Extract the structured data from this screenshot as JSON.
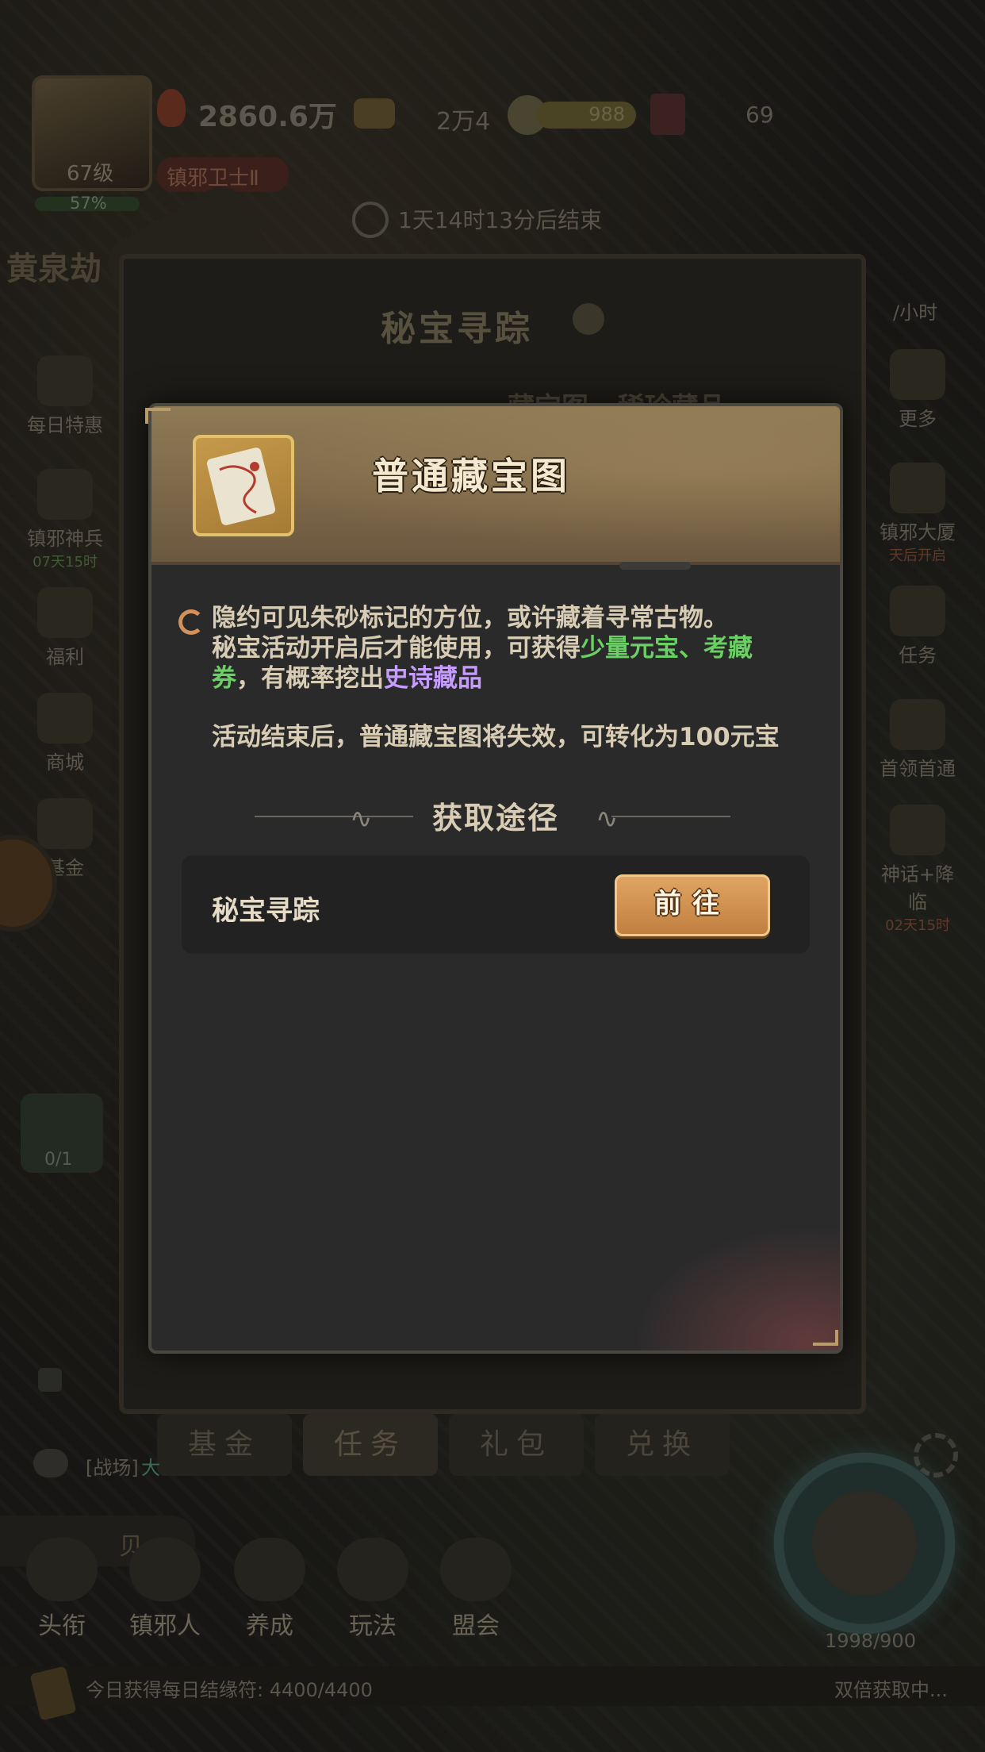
{
  "background": {
    "player": {
      "level": "67级",
      "xp_percent": "57%",
      "title_badge": "镇邪卫士Ⅱ"
    },
    "resources": {
      "power": "2860.6万",
      "gold": "2万4",
      "energy": "988",
      "tickets": "69"
    },
    "event_timer": "1天14时13分后结束",
    "event_name": "黄泉劫",
    "board_title": "秘宝寻踪",
    "board_banner": "藏宝图 · 稀珍藏品",
    "left_menu": [
      {
        "label": "每日特惠",
        "sub": ""
      },
      {
        "label": "镇邪神兵",
        "sub": "07天15时"
      },
      {
        "label": "福利",
        "sub": ""
      },
      {
        "label": "商城",
        "sub": ""
      },
      {
        "label": "基金",
        "sub": ""
      }
    ],
    "right_menu": [
      {
        "label": "更多",
        "sub": ""
      },
      {
        "label": "镇邪大厦",
        "sub": "天后开启"
      },
      {
        "label": "任务",
        "sub": ""
      },
      {
        "label": "首领首通",
        "sub": ""
      },
      {
        "label": "神话+降临",
        "sub": "02天15时"
      }
    ],
    "rate_text": "/小时",
    "counter_badge": "0/1",
    "tabs": [
      "基金",
      "任务",
      "礼包",
      "兑换"
    ],
    "chat_prefix": "[战场]",
    "chat_tail": "大",
    "chat_tag_tail": "贝",
    "bottom_nav": [
      "头衔",
      "镇邪人",
      "养成",
      "玩法",
      "盟会"
    ],
    "compass_counter": "1998/900",
    "footer_text": "今日获得每日结缘符: 4400/4400",
    "footer_right": "双倍获取中..."
  },
  "modal": {
    "title": "普通藏宝图",
    "description": {
      "line1": "隐约可见朱砂标记的方位，或许藏着寻常古物。",
      "line2_prefix": "秘宝活动开启后才能使用，可获得",
      "reward1": "少量元宝、考藏券",
      "line2_mid": "，有概率挖出",
      "reward2": "史诗藏品"
    },
    "expiry_note": "活动结束后，普通藏宝图将失效，可转化为100元宝",
    "section_title": "获取途径",
    "sources": [
      {
        "label": "秘宝寻踪",
        "button": "前往"
      }
    ]
  },
  "colors": {
    "highlight_green": "#6ad064",
    "highlight_purple": "#c69cff",
    "button_orange": "#d49455",
    "header_gold": "#8f7a56"
  }
}
